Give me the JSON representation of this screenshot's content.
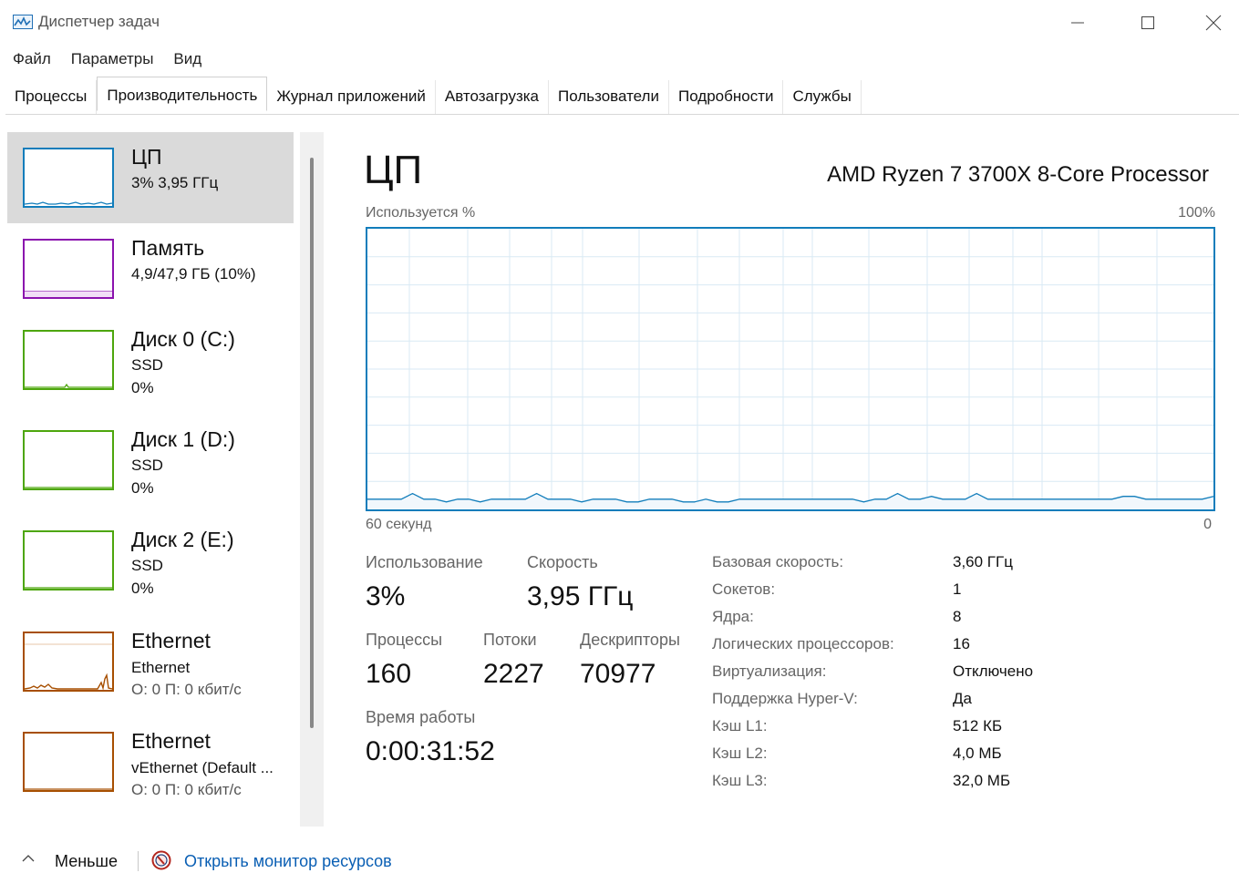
{
  "window": {
    "title": "Диспетчер задач",
    "minimize_glyph": "—",
    "maximize_glyph": "☐",
    "close_glyph": "✕"
  },
  "menu": [
    "Файл",
    "Параметры",
    "Вид"
  ],
  "tabs": [
    {
      "label": "Процессы",
      "active": false
    },
    {
      "label": "Производительность",
      "active": true
    },
    {
      "label": "Журнал приложений",
      "active": false
    },
    {
      "label": "Автозагрузка",
      "active": false
    },
    {
      "label": "Пользователи",
      "active": false
    },
    {
      "label": "Подробности",
      "active": false
    },
    {
      "label": "Службы",
      "active": false
    }
  ],
  "resources": [
    {
      "name": "ЦП",
      "line1": "3% 3,95 ГГц",
      "line2": "",
      "color": "#117dbb",
      "selected": true
    },
    {
      "name": "Память",
      "line1": "4,9/47,9 ГБ (10%)",
      "line2": "",
      "color": "#8b12ae",
      "selected": false
    },
    {
      "name": "Диск 0 (C:)",
      "line1": "SSD",
      "line2": "0%",
      "color": "#4da60c",
      "selected": false
    },
    {
      "name": "Диск 1 (D:)",
      "line1": "SSD",
      "line2": "0%",
      "color": "#4da60c",
      "selected": false
    },
    {
      "name": "Диск 2 (E:)",
      "line1": "SSD",
      "line2": "0%",
      "color": "#4da60c",
      "selected": false
    },
    {
      "name": "Ethernet",
      "line1": "Ethernet",
      "line2": "О: 0 П: 0 кбит/с",
      "color": "#a74f01",
      "selected": false
    },
    {
      "name": "Ethernet",
      "line1": "vEthernet (Default ...",
      "line2": "О: 0 П: 0 кбит/с",
      "color": "#a74f01",
      "selected": false
    }
  ],
  "main": {
    "title": "ЦП",
    "processor": "AMD Ryzen 7 3700X 8-Core Processor",
    "graph_label_left": "Используется %",
    "graph_label_right": "100%",
    "axis_left": "60 секунд",
    "axis_right": "0",
    "usage_series": [
      3,
      3,
      3,
      3,
      5,
      3,
      3,
      2,
      3,
      3,
      2,
      3,
      3,
      3,
      3,
      5,
      3,
      3,
      3,
      2,
      3,
      3,
      3,
      2,
      2,
      3,
      3,
      3,
      2,
      2,
      3,
      2,
      2,
      3,
      3,
      3,
      3,
      3,
      3,
      3,
      3,
      3,
      3,
      3,
      2,
      3,
      3,
      5,
      3,
      3,
      4,
      3,
      3,
      3,
      5,
      3,
      3,
      3,
      3,
      3,
      3,
      3,
      3,
      3,
      3,
      3,
      3,
      4,
      4,
      3,
      3,
      3,
      3,
      3,
      3,
      4
    ],
    "stats": {
      "usage_label": "Использование",
      "usage_value": "3%",
      "speed_label": "Скорость",
      "speed_value": "3,95 ГГц",
      "processes_label": "Процессы",
      "processes_value": "160",
      "threads_label": "Потоки",
      "threads_value": "2227",
      "handles_label": "Дескрипторы",
      "handles_value": "70977",
      "uptime_label": "Время работы",
      "uptime_value": "0:00:31:52"
    },
    "details": [
      {
        "label": "Базовая скорость:",
        "value": "3,60 ГГц"
      },
      {
        "label": "Сокетов:",
        "value": "1"
      },
      {
        "label": "Ядра:",
        "value": "8"
      },
      {
        "label": "Логических процессоров:",
        "value": "16"
      },
      {
        "label": "Виртуализация:",
        "value": "Отключено"
      },
      {
        "label": "Поддержка Hyper-V:",
        "value": "Да"
      },
      {
        "label": "Кэш L1:",
        "value": "512 КБ"
      },
      {
        "label": "Кэш L2:",
        "value": "4,0 МБ"
      },
      {
        "label": "Кэш L3:",
        "value": "32,0 МБ"
      }
    ]
  },
  "footer": {
    "less_label": "Меньше",
    "resource_monitor_label": "Открыть монитор ресурсов"
  },
  "colors": {
    "cpu": "#117dbb",
    "grid": "#d9eaf4",
    "link": "#0a5fb4"
  }
}
